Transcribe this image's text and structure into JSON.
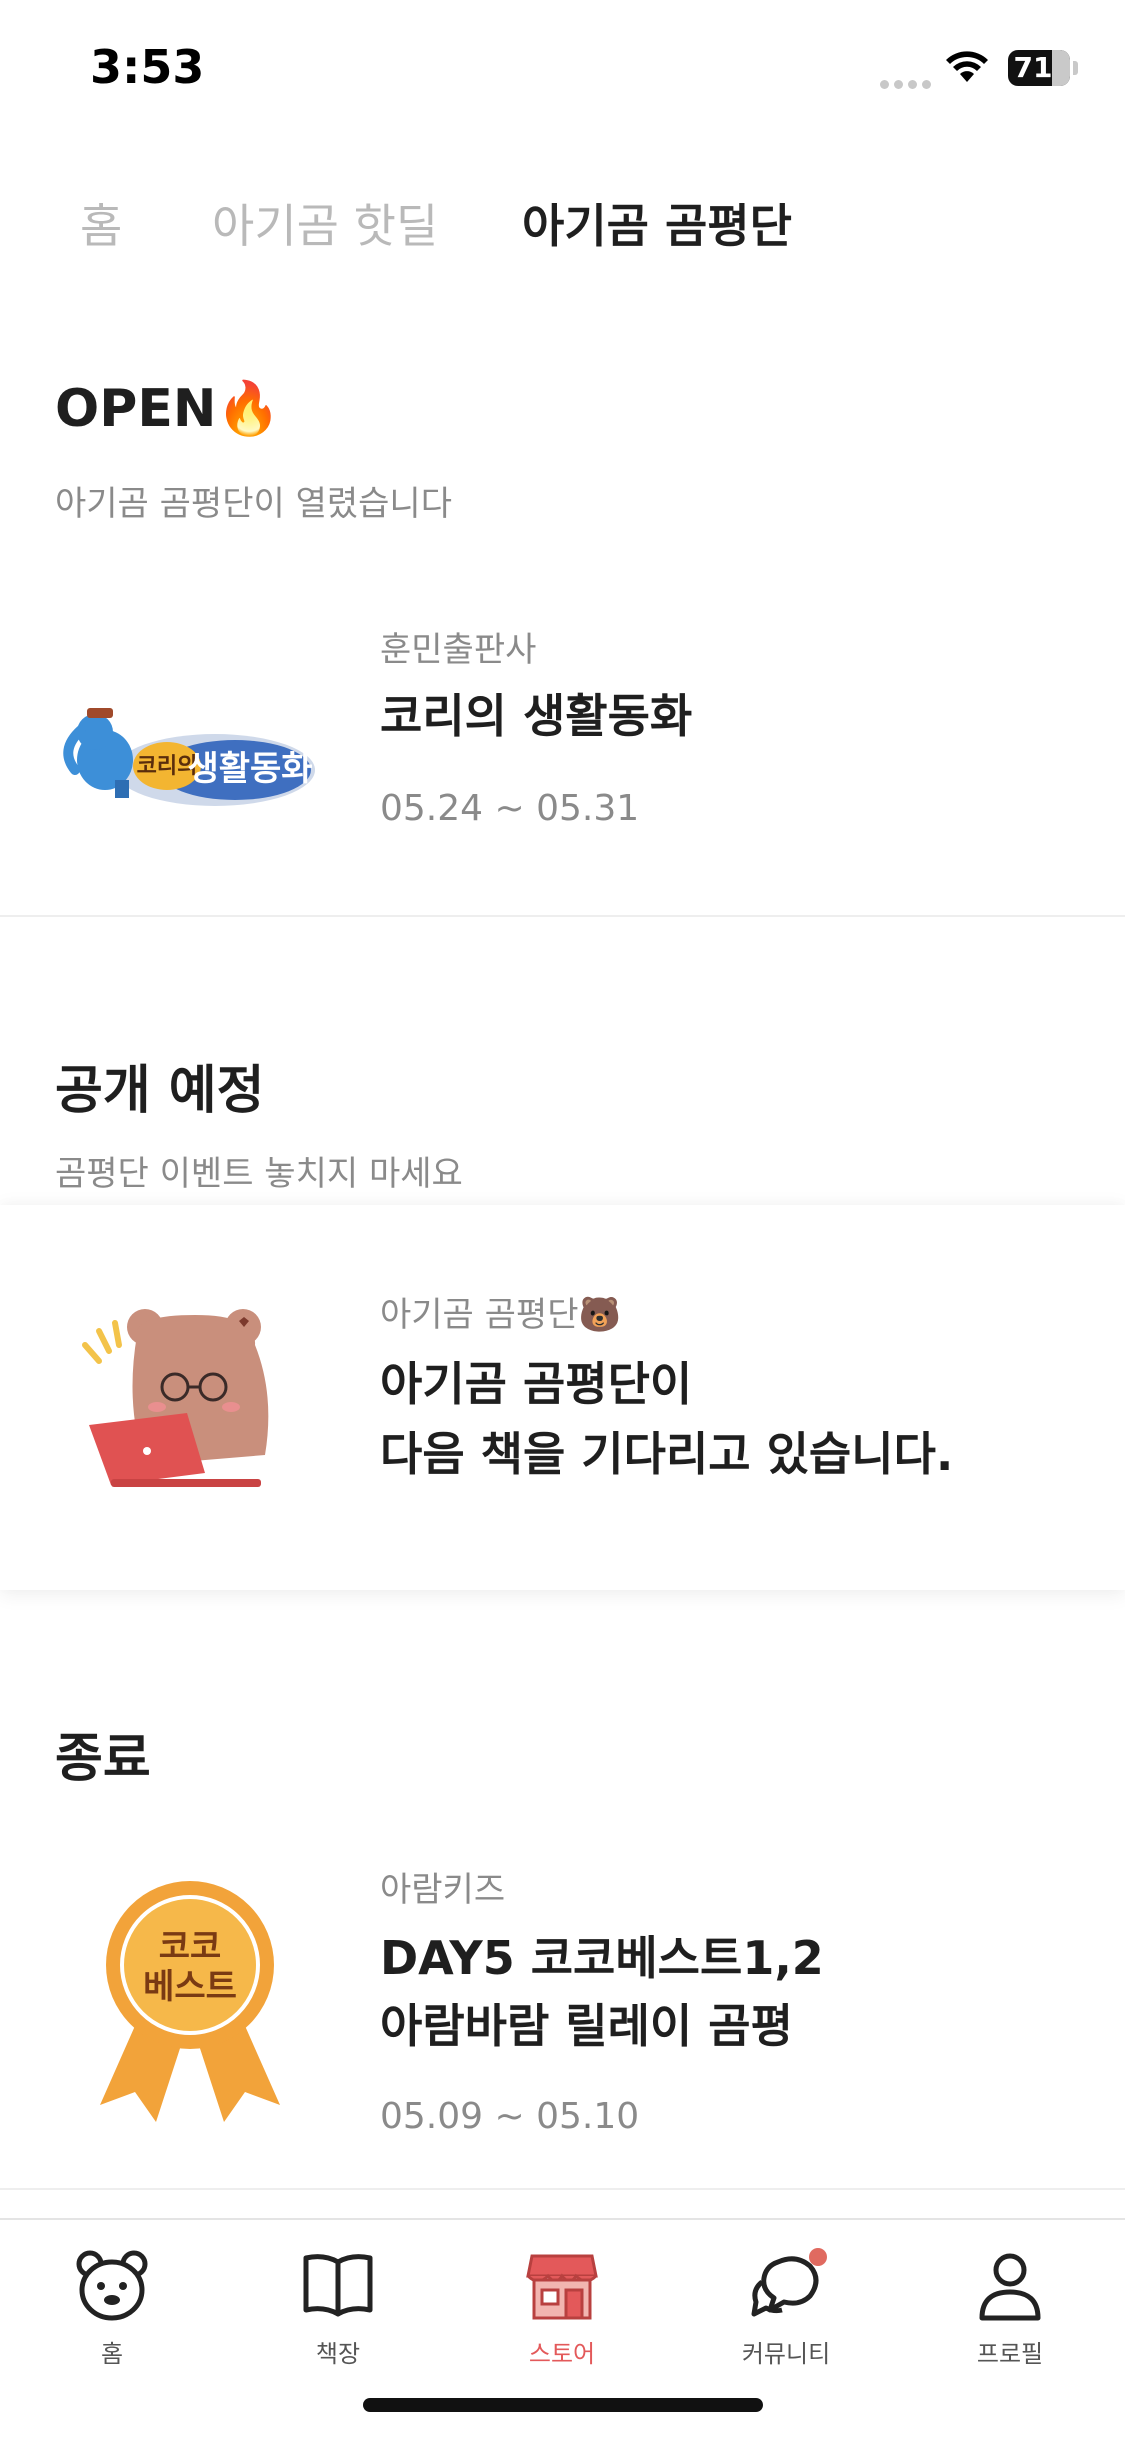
{
  "status_bar": {
    "time": "3:53",
    "battery": "71"
  },
  "tabs": [
    {
      "label": "홈",
      "active": false
    },
    {
      "label": "아기곰 핫딜",
      "active": false
    },
    {
      "label": "아기곰 곰평단",
      "active": true
    }
  ],
  "open_section": {
    "title": "OPEN🔥",
    "subtitle": "아기곰 곰평단이 열렸습니다",
    "item": {
      "publisher": "훈민출판사",
      "name": "코리의 생활동화",
      "period": "05.24 ~ 05.31",
      "thumb_text": [
        "코리의",
        "생활동화"
      ]
    }
  },
  "upcoming_section": {
    "title": "공개 예정",
    "subtitle": "곰평단 이벤트 놓치지 마세요",
    "item": {
      "publisher": "아기곰 곰평단🐻",
      "name": "아기곰 곰평단이\n다음 책을 기다리고 있습니다."
    }
  },
  "ended_section": {
    "title": "종료",
    "item": {
      "publisher": "아람키즈",
      "name": "DAY5 코코베스트1,2\n아람바람 릴레이 곰평",
      "period": "05.09 ~ 05.10",
      "thumb_text": [
        "코코",
        "베스트"
      ]
    }
  },
  "bottom_nav": [
    {
      "label": "홈",
      "icon": "bear-face-icon",
      "active": false
    },
    {
      "label": "책장",
      "icon": "open-book-icon",
      "active": false
    },
    {
      "label": "스토어",
      "icon": "store-icon",
      "active": true
    },
    {
      "label": "커뮤니티",
      "icon": "chat-bubbles-icon",
      "active": false,
      "badge": true
    },
    {
      "label": "프로필",
      "icon": "person-icon",
      "active": false
    }
  ],
  "colors": {
    "accent": "#e3595a",
    "muted": "#8a8a8a",
    "text": "#1f1f1f"
  }
}
